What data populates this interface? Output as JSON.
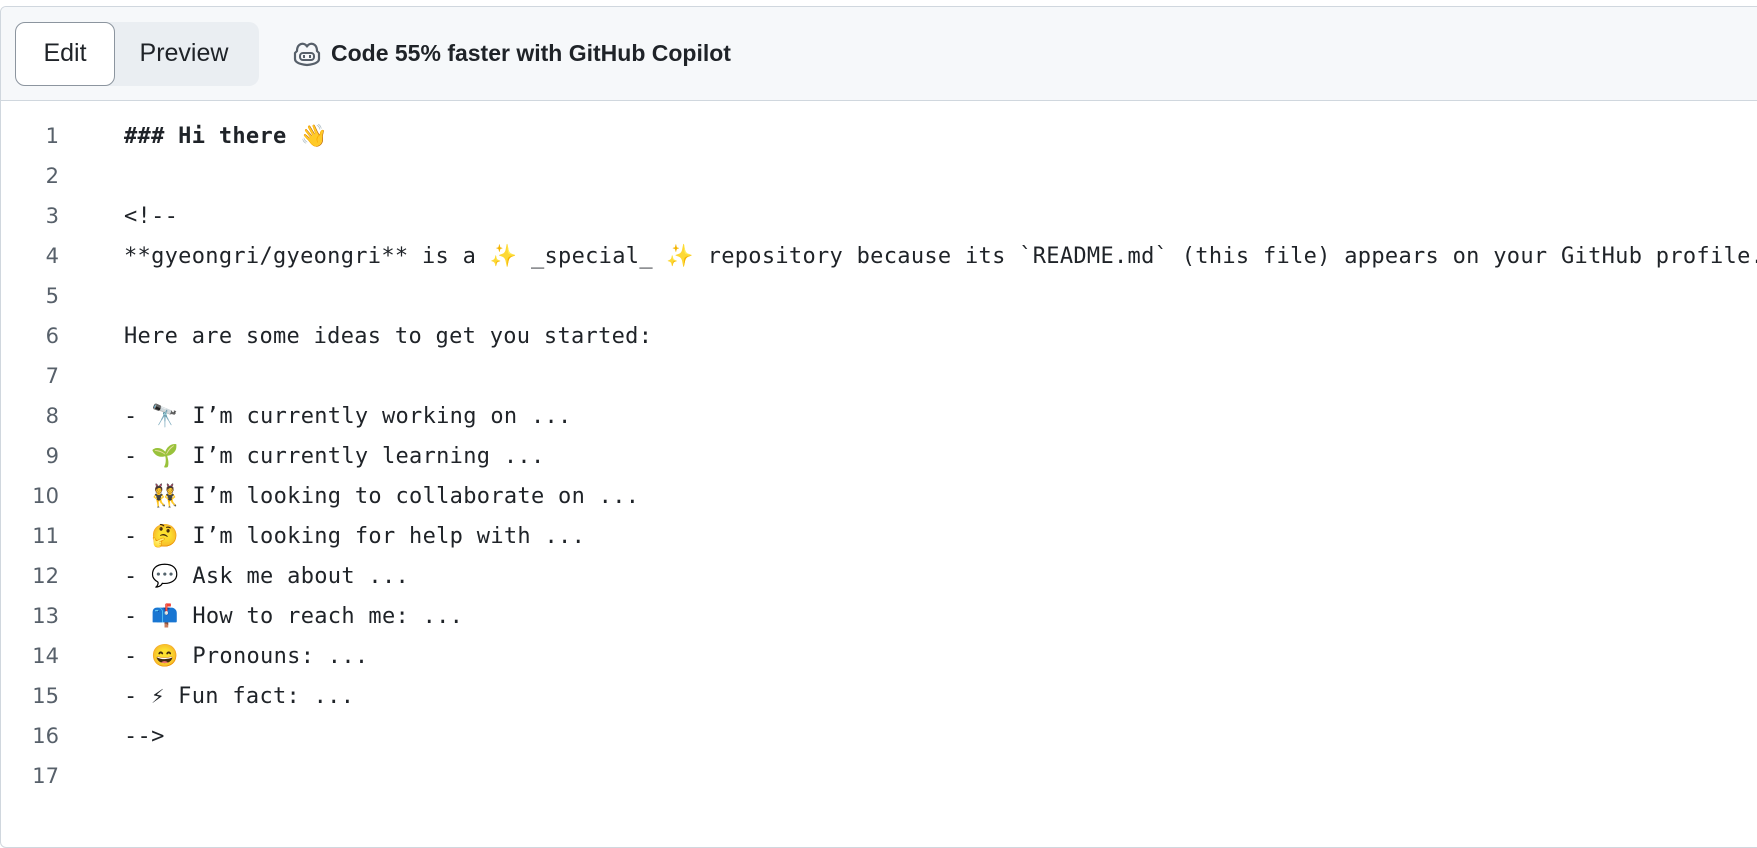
{
  "toolbar": {
    "edit_label": "Edit",
    "preview_label": "Preview",
    "copilot_label": "Code 55% faster with GitHub Copilot",
    "copilot_icon": "copilot-icon"
  },
  "editor": {
    "lines": [
      {
        "number": "1",
        "text": "### Hi there 👋"
      },
      {
        "number": "2",
        "text": ""
      },
      {
        "number": "3",
        "text": "<!--"
      },
      {
        "number": "4",
        "text": "**gyeongri/gyeongri** is a ✨ _special_ ✨ repository because its `README.md` (this file) appears on your GitHub profile."
      },
      {
        "number": "5",
        "text": ""
      },
      {
        "number": "6",
        "text": "Here are some ideas to get you started:"
      },
      {
        "number": "7",
        "text": ""
      },
      {
        "number": "8",
        "text": "- 🔭 I’m currently working on ..."
      },
      {
        "number": "9",
        "text": "- 🌱 I’m currently learning ..."
      },
      {
        "number": "10",
        "text": "- 👯 I’m looking to collaborate on ..."
      },
      {
        "number": "11",
        "text": "- 🤔 I’m looking for help with ..."
      },
      {
        "number": "12",
        "text": "- 💬 Ask me about ..."
      },
      {
        "number": "13",
        "text": "- 📫 How to reach me: ..."
      },
      {
        "number": "14",
        "text": "- 😄 Pronouns: ..."
      },
      {
        "number": "15",
        "text": "- ⚡ Fun fact: ..."
      },
      {
        "number": "16",
        "text": "-->"
      },
      {
        "number": "17",
        "text": ""
      }
    ]
  }
}
